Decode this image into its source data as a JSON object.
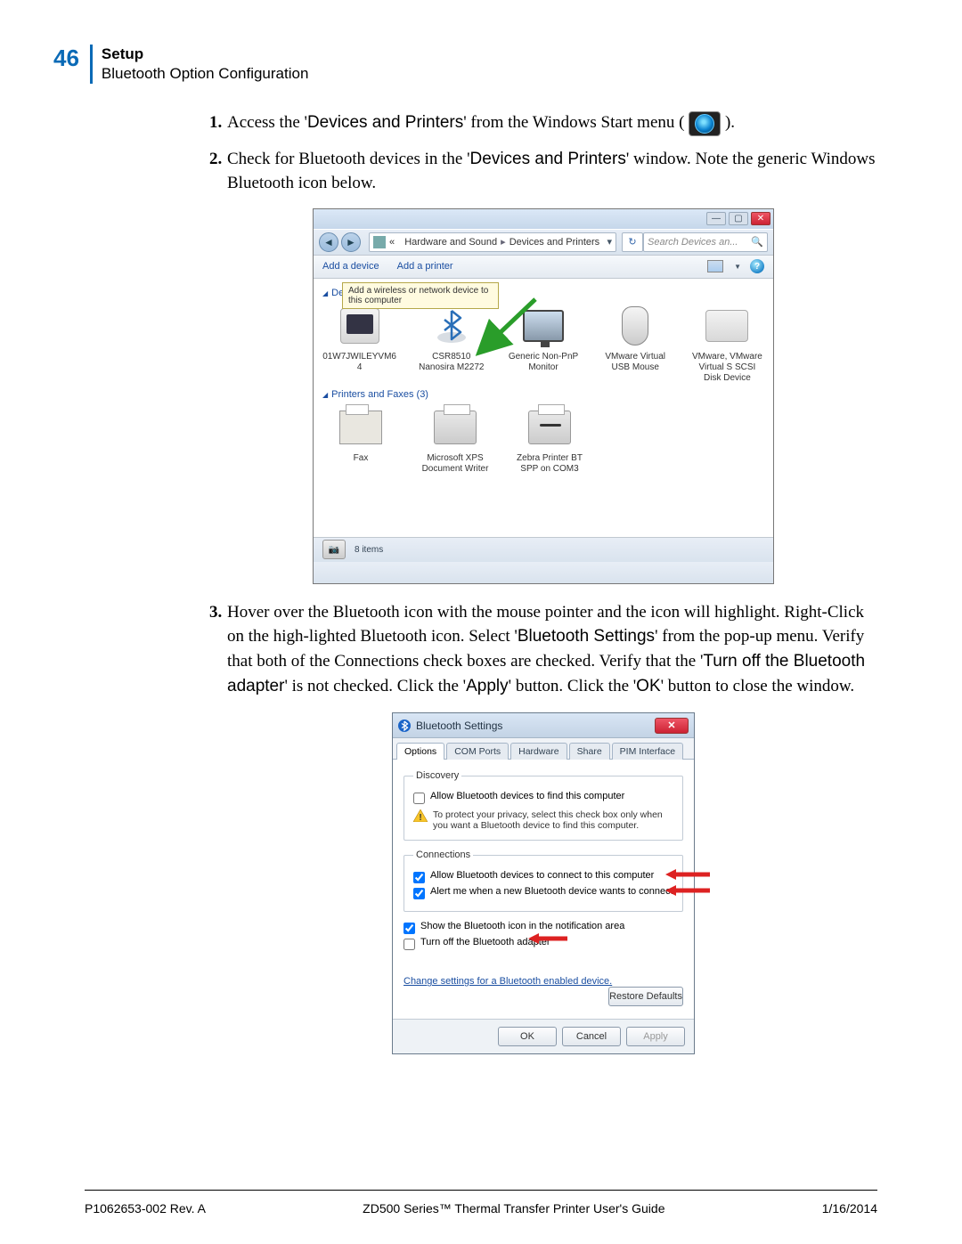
{
  "page_number": "46",
  "header": {
    "title": "Setup",
    "subtitle": "Bluetooth Option Configuration"
  },
  "steps": {
    "s1": {
      "num": "1.",
      "pre": "Access the '",
      "term": "Devices and Printers",
      "post": "' from the Windows Start menu ( ",
      "end": " )."
    },
    "s2": {
      "num": "2.",
      "pre": "Check for Bluetooth devices in the '",
      "term": "Devices and Printers",
      "post": "' window. Note the generic Windows Bluetooth icon below."
    },
    "s3": {
      "num": "3.",
      "p1": "Hover over the Bluetooth icon with the mouse pointer and the icon will highlight. Right-Click on the high-lighted Bluetooth icon. Select '",
      "t1": "Bluetooth Settings",
      "p2": "' from the pop-up menu. Verify that both of the Connections check boxes are checked. Verify that the '",
      "t2": "Turn off the Bluetooth adapter",
      "p3": "' is not checked. Click the '",
      "t3": "Apply",
      "p4": "' button. Click the '",
      "t4": "OK",
      "p5": "' button to close the window."
    }
  },
  "shot1": {
    "breadcrumb": {
      "bullet": "«",
      "b1": "Hardware and Sound",
      "b2": "Devices and Printers"
    },
    "search_placeholder": "Search Devices an...",
    "toolbar": {
      "add_device": "Add a device",
      "add_printer": "Add a printer"
    },
    "tooltip": "Add a wireless or network device to this computer",
    "cat_devices_prefix": "Devi",
    "cat_printers": "Printers and Faxes (3)",
    "devices": {
      "d1": {
        "l1": "01W7JWILEYVM6",
        "l2": "4"
      },
      "d2": {
        "l1": "CSR8510",
        "l2": "Nanosira M2272"
      },
      "d3": {
        "l1": "Generic Non-PnP",
        "l2": "Monitor"
      },
      "d4": {
        "l1": "VMware Virtual",
        "l2": "USB Mouse"
      },
      "d5": {
        "l1": "VMware, VMware",
        "l2": "Virtual S SCSI",
        "l3": "Disk Device"
      }
    },
    "printers": {
      "p1": {
        "l1": "Fax"
      },
      "p2": {
        "l1": "Microsoft XPS",
        "l2": "Document Writer"
      },
      "p3": {
        "l1": "Zebra Printer BT",
        "l2": "SPP on COM3"
      }
    },
    "status": "8 items"
  },
  "shot2": {
    "title": "Bluetooth Settings",
    "tabs": {
      "t1": "Options",
      "t2": "COM Ports",
      "t3": "Hardware",
      "t4": "Share",
      "t5": "PIM Interface"
    },
    "discovery": {
      "legend": "Discovery",
      "chk": "Allow Bluetooth devices to find this computer",
      "warn": "To protect your privacy, select this check box only when you want a Bluetooth device to find this computer."
    },
    "connections": {
      "legend": "Connections",
      "chk1": "Allow Bluetooth devices to connect to this computer",
      "chk2": "Alert me when a new Bluetooth device wants to connect"
    },
    "chk_notify": "Show the Bluetooth icon in the notification area",
    "chk_turnoff": "Turn off the Bluetooth adapter",
    "link": "Change settings for a Bluetooth enabled device.",
    "restore": "Restore Defaults",
    "ok": "OK",
    "cancel": "Cancel",
    "apply": "Apply"
  },
  "footer": {
    "left": "P1062653-002 Rev. A",
    "center": "ZD500 Series™ Thermal Transfer Printer User's Guide",
    "right": "1/16/2014"
  }
}
